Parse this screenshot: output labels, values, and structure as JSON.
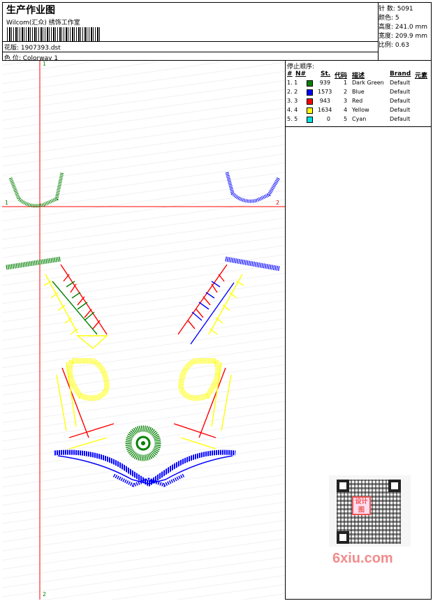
{
  "header": {
    "title": "生产作业图",
    "studio": "Wilcom(汇众) 绣饰工作室",
    "design_label": "花版: 1907393.dst",
    "colorway_label": "色 位: Colorway 1"
  },
  "stats": {
    "stitches": "针 数: 5091",
    "colors": "颜色: 5",
    "height": "高度: 241.0 mm",
    "width": "宽度: 209.9 mm",
    "scale": "比例: 0.63"
  },
  "axes": {
    "v_top": "1",
    "v_bottom": "2",
    "h_left": "1",
    "h_right": "2"
  },
  "stop_order": {
    "title": "停止顺序:",
    "headers": {
      "num": "#",
      "n": "N#",
      "st": "St.",
      "code": "代码",
      "desc": "描述",
      "brand": "Brand",
      "element": "元素"
    },
    "rows": [
      {
        "idx": "1. 1",
        "color": "#008000",
        "st": "939",
        "code": "1",
        "desc": "Dark Green",
        "brand": "Default"
      },
      {
        "idx": "2. 2",
        "color": "#0000ff",
        "st": "1573",
        "code": "2",
        "desc": "Blue",
        "brand": "Default"
      },
      {
        "idx": "3. 3",
        "color": "#ff0000",
        "st": "943",
        "code": "3",
        "desc": "Red",
        "brand": "Default"
      },
      {
        "idx": "4. 4",
        "color": "#ffff00",
        "st": "1634",
        "code": "4",
        "desc": "Yellow",
        "brand": "Default"
      },
      {
        "idx": "5. 5",
        "color": "#00e0e0",
        "st": "0",
        "code": "5",
        "desc": "Cyan",
        "brand": "Default"
      }
    ]
  },
  "watermark": {
    "stamp": "设计图",
    "site": "6xiu.com"
  }
}
